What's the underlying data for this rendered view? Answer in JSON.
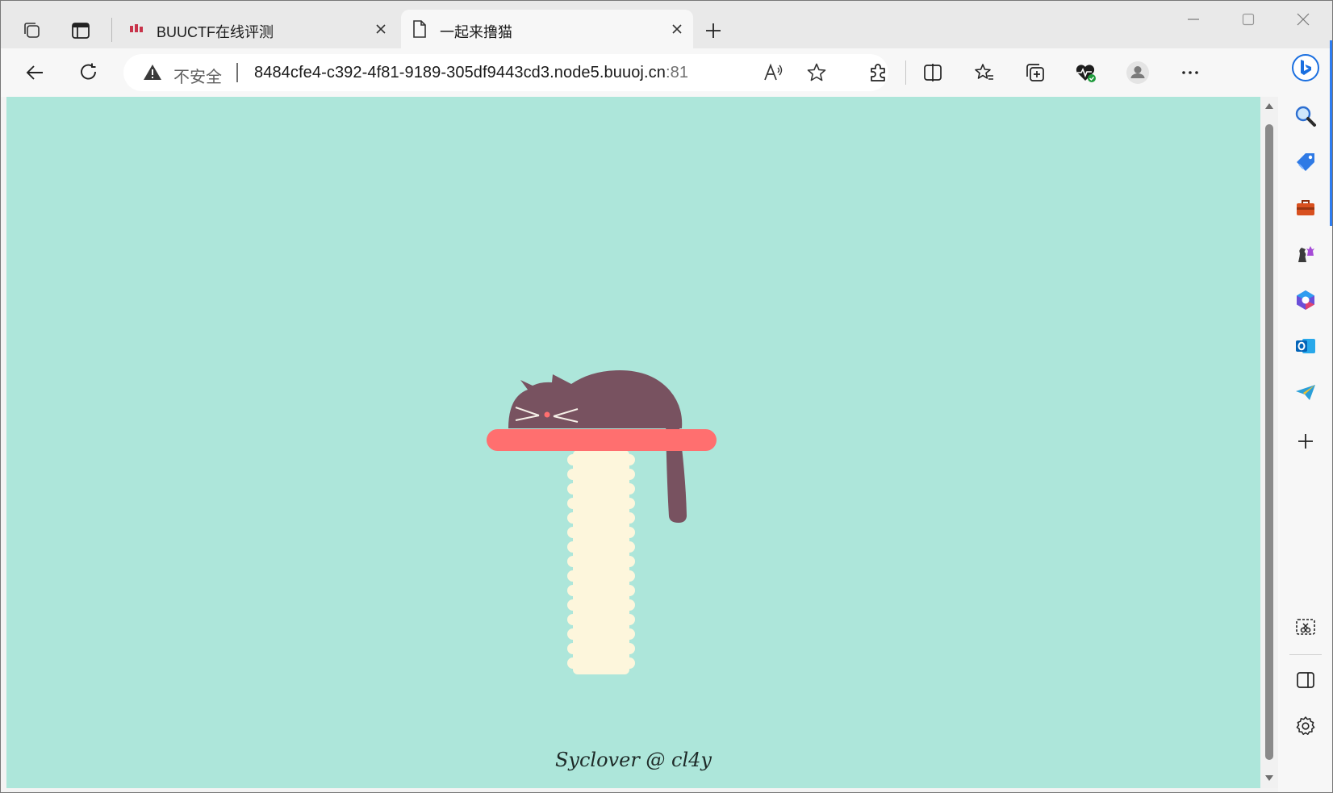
{
  "browser": {
    "tabs": [
      {
        "title": "BUUCTF在线评测",
        "active": false,
        "favicon": "buuctf-favicon-icon"
      },
      {
        "title": "一起来撸猫",
        "active": true,
        "favicon": "page-icon"
      }
    ],
    "address_bar": {
      "security_label": "不安全",
      "url_host": "8484cfe4-c392-4f81-9189-305df9443cd3.node5.buuoj.cn",
      "url_port": ":81"
    },
    "icons": {
      "workspaces": "workspaces-icon",
      "tab_actions": "vertical-tabs-icon",
      "back": "back-arrow-icon",
      "refresh": "refresh-icon",
      "read_aloud": "read-aloud-icon",
      "favorite": "star-icon",
      "extensions": "puzzle-icon",
      "split_screen": "split-screen-icon",
      "favorites": "favorites-icon",
      "collections": "collections-icon",
      "performance": "heart-pulse-icon",
      "profile": "profile-icon",
      "more": "more-icon",
      "copilot": "bing-copilot-icon"
    },
    "sidebar": [
      "search-icon",
      "shopping-tag-icon",
      "tools-briefcase-icon",
      "games-chess-icon",
      "microsoft365-icon",
      "outlook-icon",
      "telegram-icon",
      "add-icon",
      "screenshot-icon",
      "sidebar-toggle-icon",
      "settings-icon"
    ],
    "colors": {
      "page_background": "#ade6da",
      "shelf": "#ff6f6f",
      "post": "#fdf6dc",
      "cat": "#785260",
      "accent": "#2d7cf0"
    }
  },
  "page": {
    "footer": "Syclover @ cl4y"
  }
}
